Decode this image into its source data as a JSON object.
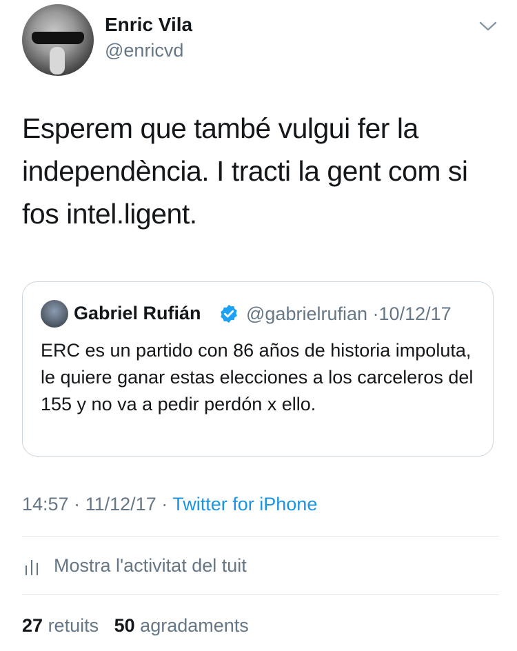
{
  "author": {
    "name": "Enric Vila",
    "handle": "@enricvd"
  },
  "tweet": {
    "text": "Esperem que també vulgui fer la independència. I tracti la gent com si fos intel.ligent."
  },
  "quoted_tweet": {
    "name": "Gabriel Rufián",
    "verified": true,
    "handle": "@gabrielrufian",
    "separator": "·",
    "date": "10/12/17",
    "text": "ERC es un partido con 86 años de historia impoluta, le quiere ganar estas elecciones a los carceleros del 155 y no va a pedir perdón x ello."
  },
  "meta": {
    "time": "14:57",
    "separator": "·",
    "date": "11/12/17",
    "source": "Twitter for iPhone"
  },
  "activity": {
    "label": "Mostra l'activitat del tuit"
  },
  "stats": {
    "retweets_count": "27",
    "retweets_label": "retuits",
    "likes_count": "50",
    "likes_label": "agradaments"
  },
  "icons": {
    "chevron": "chevron-down-icon",
    "verified": "verified-badge-icon",
    "activity": "bar-chart-icon"
  },
  "colors": {
    "text": "#14171a",
    "secondary": "#657786",
    "link": "#1b95e0",
    "border": "#ccd6dd"
  }
}
